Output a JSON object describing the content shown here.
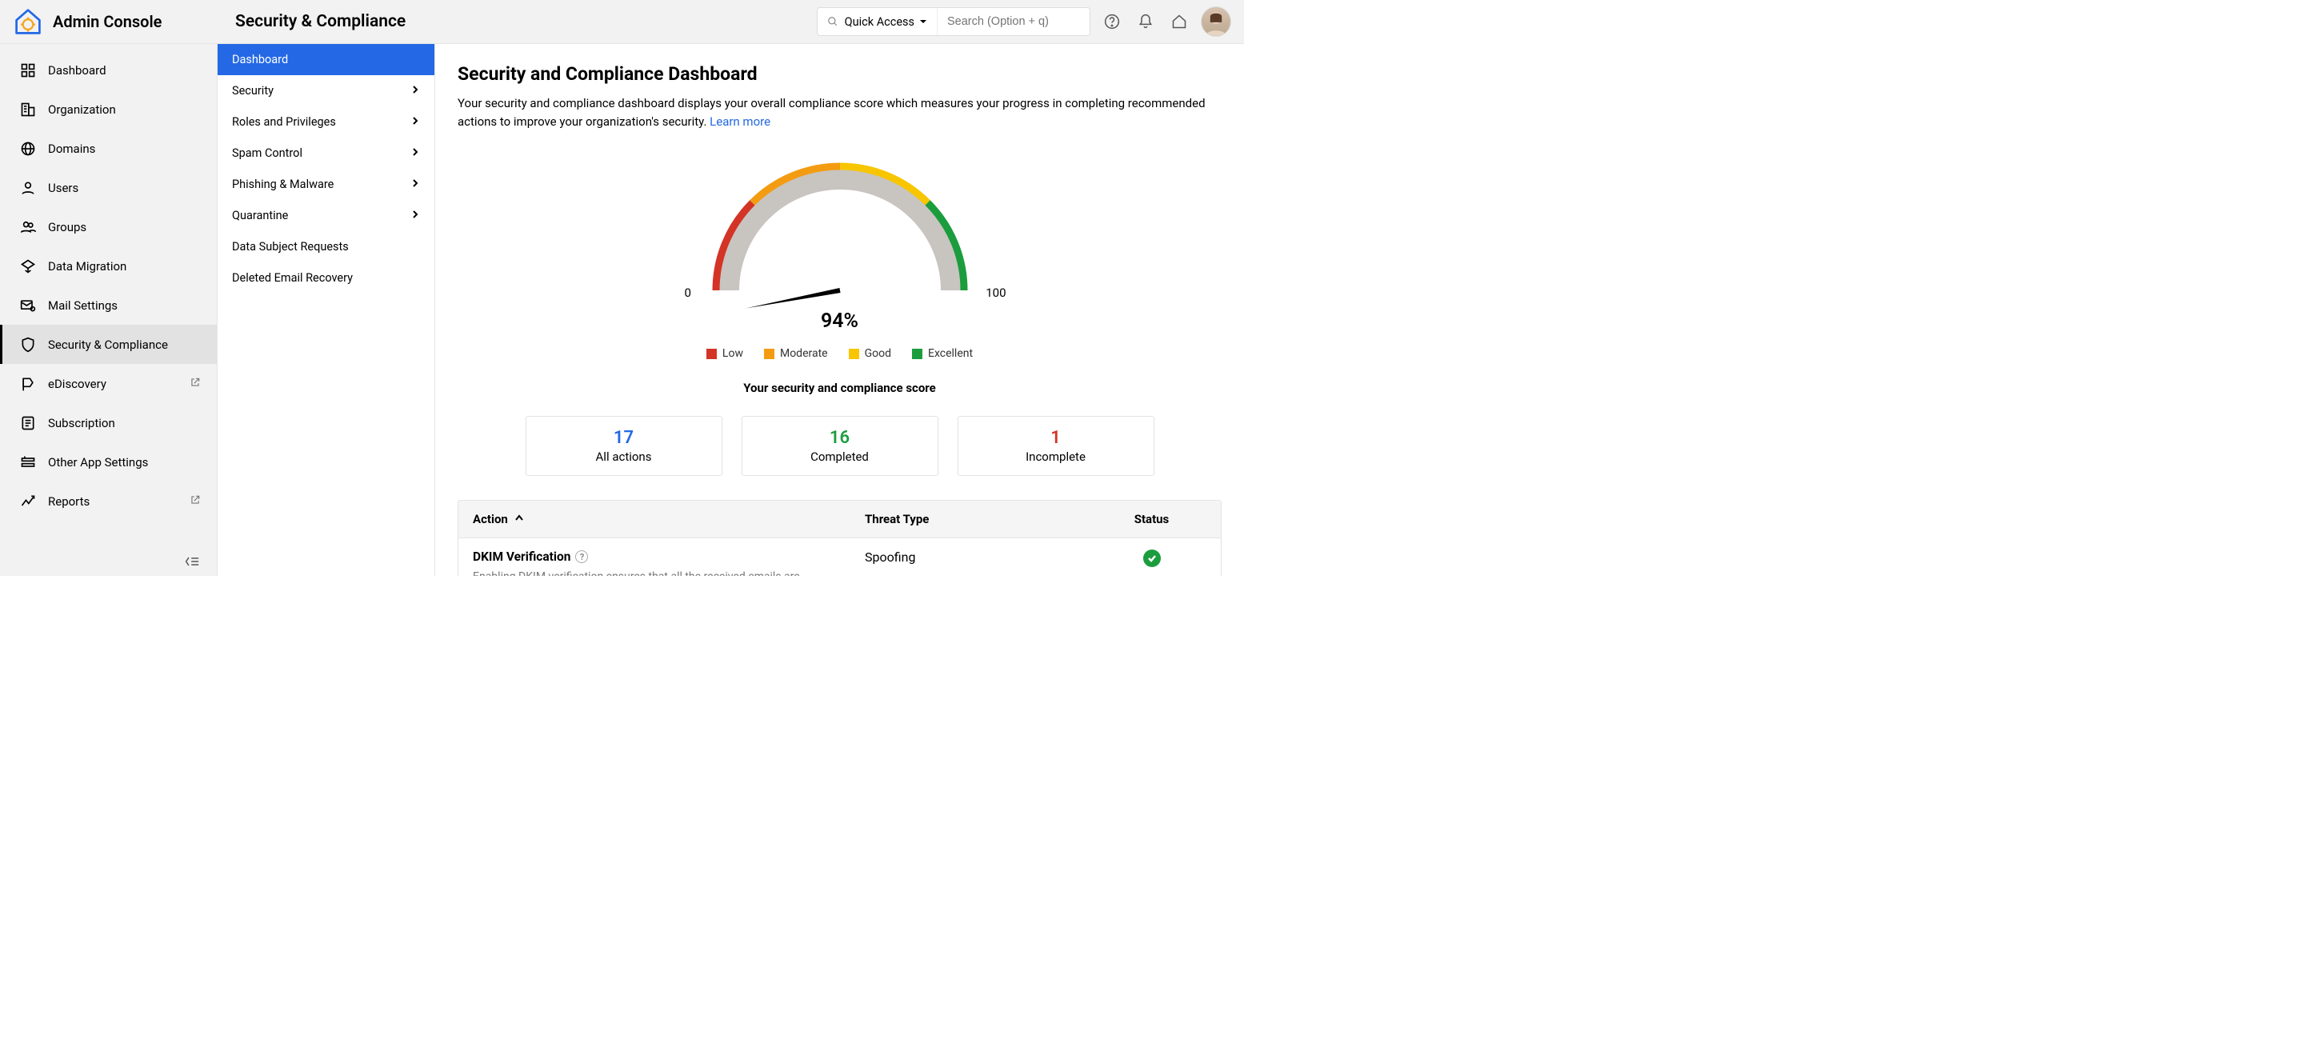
{
  "app_title": "Admin Console",
  "header_title": "Security & Compliance",
  "quick_access_label": "Quick Access",
  "search_placeholder": "Search (Option + q)",
  "sidebar1": [
    {
      "label": "Dashboard",
      "icon": "dashboard"
    },
    {
      "label": "Organization",
      "icon": "organization"
    },
    {
      "label": "Domains",
      "icon": "globe"
    },
    {
      "label": "Users",
      "icon": "user"
    },
    {
      "label": "Groups",
      "icon": "users"
    },
    {
      "label": "Data Migration",
      "icon": "migration"
    },
    {
      "label": "Mail Settings",
      "icon": "mail-gear"
    },
    {
      "label": "Security & Compliance",
      "icon": "shield",
      "active": true
    },
    {
      "label": "eDiscovery",
      "icon": "ediscovery",
      "external": true
    },
    {
      "label": "Subscription",
      "icon": "subscription"
    },
    {
      "label": "Other App Settings",
      "icon": "apps"
    },
    {
      "label": "Reports",
      "icon": "reports",
      "external": true
    }
  ],
  "sidebar2": [
    {
      "label": "Dashboard",
      "active": true,
      "chev": false
    },
    {
      "label": "Security",
      "chev": true
    },
    {
      "label": "Roles and Privileges",
      "chev": true
    },
    {
      "label": "Spam Control",
      "chev": true
    },
    {
      "label": "Phishing & Malware",
      "chev": true
    },
    {
      "label": "Quarantine",
      "chev": true
    },
    {
      "label": "Data Subject Requests",
      "chev": false
    },
    {
      "label": "Deleted Email Recovery",
      "chev": false
    }
  ],
  "main": {
    "title": "Security and Compliance Dashboard",
    "description_pre": "Your security and compliance dashboard displays your overall compliance score which measures your progress in completing recommended actions to improve your organization's security.  ",
    "learn_more": "Learn more",
    "score_value_label": "94%",
    "score_caption": "Your security and compliance score",
    "gauge_min": "0",
    "gauge_max": "100",
    "legend": [
      {
        "label": "Low",
        "color": "#d33426"
      },
      {
        "label": "Moderate",
        "color": "#f39c12"
      },
      {
        "label": "Good",
        "color": "#f7c600"
      },
      {
        "label": "Excellent",
        "color": "#1b9d3e"
      }
    ],
    "stats": [
      {
        "value": "17",
        "label": "All actions",
        "cls": "blue"
      },
      {
        "value": "16",
        "label": "Completed",
        "cls": "green"
      },
      {
        "value": "1",
        "label": "Incomplete",
        "cls": "red"
      }
    ],
    "table": {
      "headers": {
        "action": "Action",
        "threat": "Threat Type",
        "status": "Status"
      },
      "rows": [
        {
          "title": "DKIM Verification",
          "desc": "Enabling DKIM verification ensures that all the received emails are checked for sender authenticity and avoids the chances of email spoofing.",
          "threat": "Spoofing",
          "status": "ok"
        }
      ]
    }
  },
  "chart_data": {
    "type": "gauge",
    "value": 94,
    "min": 0,
    "max": 100,
    "unit": "%",
    "title": "Your security and compliance score",
    "bands": [
      {
        "name": "Low",
        "range": [
          0,
          25
        ],
        "color": "#d33426"
      },
      {
        "name": "Moderate",
        "range": [
          25,
          50
        ],
        "color": "#f39c12"
      },
      {
        "name": "Good",
        "range": [
          50,
          75
        ],
        "color": "#f7c600"
      },
      {
        "name": "Excellent",
        "range": [
          75,
          100
        ],
        "color": "#1b9d3e"
      }
    ]
  },
  "colors": {
    "primary_blue": "#2468e5",
    "green": "#1b9d3e",
    "red": "#d33426"
  }
}
